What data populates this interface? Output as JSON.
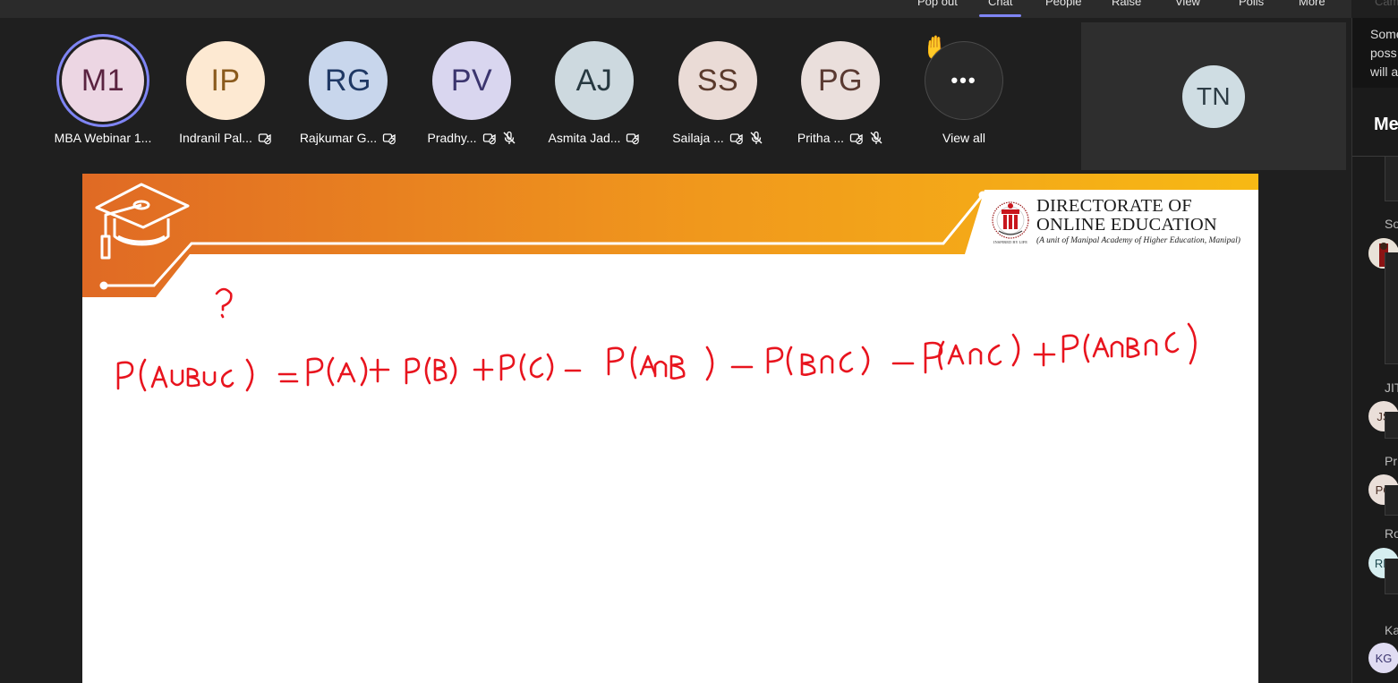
{
  "toolbar": {
    "items": [
      "Pop out",
      "Chat",
      "People",
      "Raise",
      "View",
      "Polls",
      "More"
    ],
    "active": "Chat",
    "faded": "Cam"
  },
  "participants": [
    {
      "initials": "M1",
      "name": "MBA Webinar 1...",
      "bg": "#ecd6e3",
      "fg": "#5a2340",
      "speaking": true,
      "video_off": false,
      "muted": false
    },
    {
      "initials": "IP",
      "name": "Indranil Pal...",
      "bg": "#fde9d2",
      "fg": "#8a5a1c",
      "speaking": false,
      "video_off": true,
      "muted": false
    },
    {
      "initials": "RG",
      "name": "Rajkumar G...",
      "bg": "#c8d6ec",
      "fg": "#1f3864",
      "speaking": false,
      "video_off": true,
      "muted": false
    },
    {
      "initials": "PV",
      "name": "Pradhy...",
      "bg": "#d9d6ef",
      "fg": "#3b356e",
      "speaking": false,
      "video_off": true,
      "muted": true
    },
    {
      "initials": "AJ",
      "name": "Asmita Jad...",
      "bg": "#cdd9df",
      "fg": "#263840",
      "speaking": false,
      "video_off": true,
      "muted": false
    },
    {
      "initials": "SS",
      "name": "Sailaja ...",
      "bg": "#eadbd6",
      "fg": "#5a3a2c",
      "speaking": false,
      "video_off": true,
      "muted": true
    },
    {
      "initials": "PG",
      "name": "Pritha ...",
      "bg": "#eadfdc",
      "fg": "#5a3a32",
      "speaking": false,
      "video_off": true,
      "muted": true
    }
  ],
  "view_all": {
    "label": "View all",
    "icon": "more-dots-icon"
  },
  "raised_hand_icon": "raised-hand-icon",
  "spotlight": {
    "initials": "TN"
  },
  "slide": {
    "org_line1": "DIRECTORATE OF",
    "org_line2": "ONLINE EDUCATION",
    "org_line3": "(A unit of Manipal Academy of Higher Education, Manipal)",
    "logo_motto": "INSPIRED BY LIFE",
    "handwriting": "P(A∪B∪C) = P(A)+P(B)+P(C) − P(A∩B) − P(B∩C) − P(A∩C) + P(A∩B∩C)",
    "annotation": "?",
    "ink_color": "#e8141e"
  },
  "panel": {
    "banner_lines": [
      "Some",
      "poss",
      "will a"
    ],
    "title": "Me",
    "messages": [
      {
        "sender": "So",
        "avatar": "photo"
      },
      {
        "sender": "JIT",
        "avatar": "JS"
      },
      {
        "sender": "Pr",
        "avatar": "PG"
      },
      {
        "sender": "Ro",
        "avatar": "RM"
      },
      {
        "sender": "Ka",
        "avatar": "KG"
      }
    ]
  }
}
